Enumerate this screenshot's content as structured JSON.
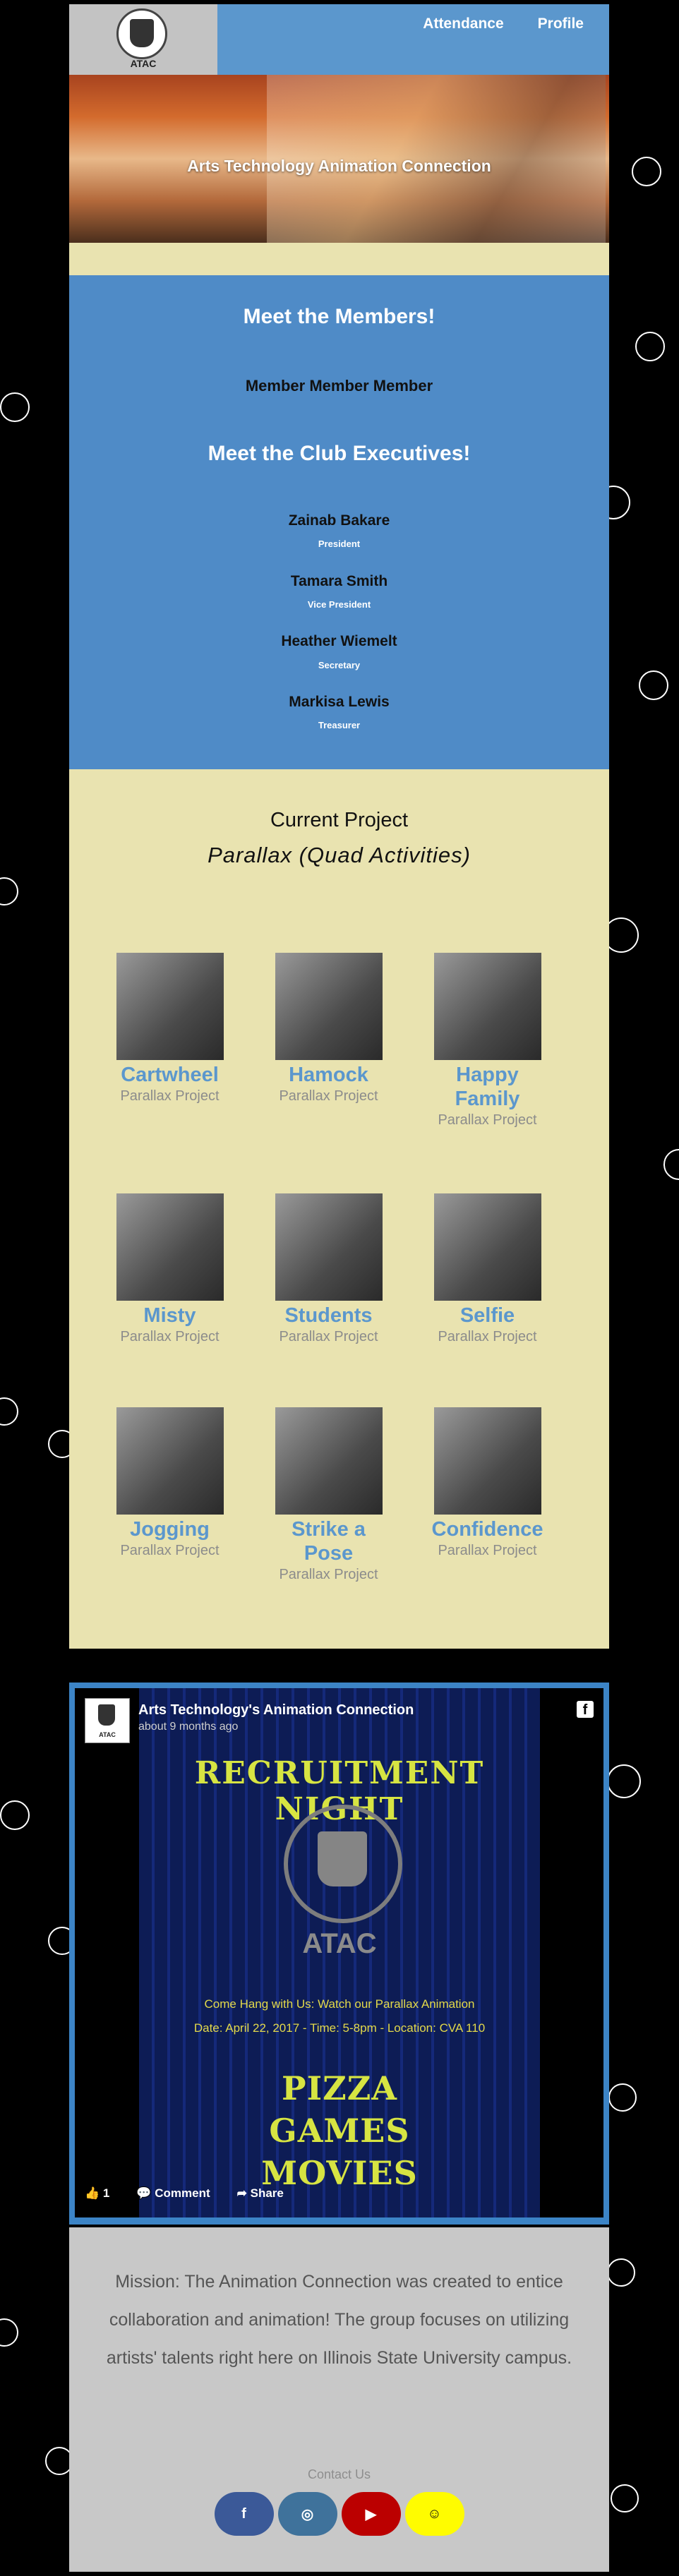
{
  "nav": {
    "logo_text": "ATAC",
    "links": [
      "Attendance",
      "Profile"
    ]
  },
  "hero": {
    "title": "Arts Technology Animation Connection"
  },
  "members": {
    "heading": "Meet the Members!",
    "member_line": "Member Member Member",
    "exec_heading": "Meet the Club Executives!",
    "executives": [
      {
        "name": "Zainab Bakare",
        "role": "President"
      },
      {
        "name": "Tamara Smith",
        "role": "Vice President"
      },
      {
        "name": "Heather Wiemelt",
        "role": "Secretary"
      },
      {
        "name": "Markisa Lewis",
        "role": "Treasurer"
      }
    ]
  },
  "project": {
    "heading": "Current Project",
    "name": "Parallax (Quad Activities)",
    "items": [
      {
        "title": "Cartwheel",
        "sub": "Parallax Project"
      },
      {
        "title": "Hamock",
        "sub": "Parallax Project"
      },
      {
        "title": "Happy Family",
        "sub": "Parallax Project"
      },
      {
        "title": "Misty",
        "sub": "Parallax Project"
      },
      {
        "title": "Students",
        "sub": "Parallax Project"
      },
      {
        "title": "Selfie",
        "sub": "Parallax Project"
      },
      {
        "title": "Jogging",
        "sub": "Parallax Project"
      },
      {
        "title": "Strike a Pose",
        "sub": "Parallax Project"
      },
      {
        "title": "Confidence",
        "sub": "Parallax Project"
      }
    ]
  },
  "facebook": {
    "page_name": "Arts Technology's Animation Connection",
    "time": "about 9 months ago",
    "poster_title": "RECRUITMENT NIGHT",
    "poster_atac": "ATAC",
    "poster_line1": "Come Hang with Us: Watch our Parallax Animation",
    "poster_line2": "Date: April 22, 2017 - Time: 5-8pm - Location: CVA 110",
    "poster_words": [
      "PIZZA",
      "GAMES",
      "MOVIES"
    ],
    "likes": "1",
    "comment_label": "Comment",
    "share_label": "Share"
  },
  "footer": {
    "mission": "Mission: The Animation Connection was created to entice collaboration and animation! The group focuses on utilizing artists' talents right here on Illinois State University campus.",
    "contact": "Contact Us",
    "socials": [
      {
        "icon": "facebook-icon",
        "color": "#3b5998"
      },
      {
        "icon": "instagram-icon",
        "color": "#3f729b"
      },
      {
        "icon": "youtube-icon",
        "color": "#bb0000"
      },
      {
        "icon": "snapchat-icon",
        "color": "#fffc00"
      }
    ]
  }
}
